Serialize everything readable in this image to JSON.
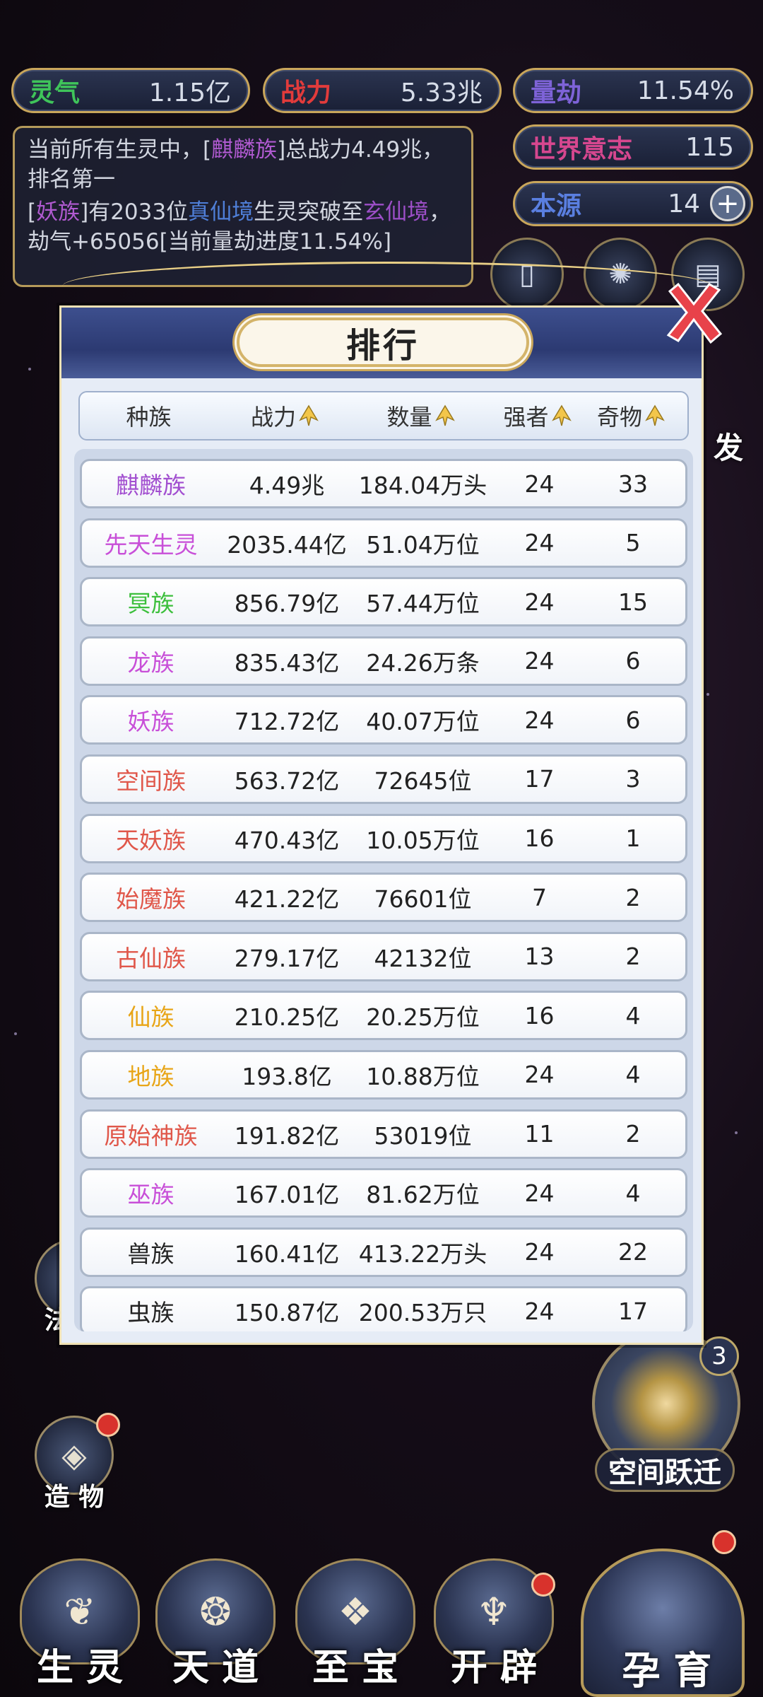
{
  "hud": {
    "lingqi": {
      "label": "灵气",
      "value": "1.15亿",
      "color": "#3fc45a"
    },
    "zhanli": {
      "label": "战力",
      "value": "5.33兆",
      "color": "#e23b3b"
    },
    "liangjie": {
      "label": "量劫",
      "value": "11.54%",
      "color": "#7e63d8"
    },
    "shijie": {
      "label": "世界意志",
      "value": "115",
      "color": "#d6478f"
    },
    "benyuan": {
      "label": "本源",
      "value": "14",
      "color": "#5a7fe0",
      "plus": "+"
    }
  },
  "messages": {
    "line1_a": "当前所有生灵中，[",
    "line1_race": "麒麟族",
    "line1_b": "]总战力4.49兆，排名第一",
    "line2_a": "[",
    "line2_race": "妖族",
    "line2_b": "]有2033位",
    "line2_realm": "真仙境",
    "line2_c": "生灵突破至",
    "line2_realm2": "玄仙境",
    "line2_d": "，劫气+65056[当前量劫进度11.54%]"
  },
  "side_buttons": {
    "fa_ze": "法 则",
    "zao_wu": "造 物",
    "burst_partial": "发",
    "jump": "空间跃迁",
    "jump_badge": "3"
  },
  "bottom_nav": {
    "sheng_ling": "生 灵",
    "tian_dao": "天 道",
    "zhi_bao": "至 宝",
    "kai_pi": "开 辟",
    "yun_yu": "孕 育"
  },
  "modal": {
    "title": "排行",
    "columns": [
      "种族",
      "战力",
      "数量",
      "强者",
      "奇物"
    ],
    "rows": [
      {
        "race": "麒麟族",
        "color": "#a24fd0",
        "power": "4.49兆",
        "count": "184.04万头",
        "strong": "24",
        "treasure": "33"
      },
      {
        "race": "先天生灵",
        "color": "#c84fd8",
        "power": "2035.44亿",
        "count": "51.04万位",
        "strong": "24",
        "treasure": "5"
      },
      {
        "race": "冥族",
        "color": "#3cbf3c",
        "power": "856.79亿",
        "count": "57.44万位",
        "strong": "24",
        "treasure": "15"
      },
      {
        "race": "龙族",
        "color": "#c84fd8",
        "power": "835.43亿",
        "count": "24.26万条",
        "strong": "24",
        "treasure": "6"
      },
      {
        "race": "妖族",
        "color": "#c84fd8",
        "power": "712.72亿",
        "count": "40.07万位",
        "strong": "24",
        "treasure": "6"
      },
      {
        "race": "空间族",
        "color": "#e0574a",
        "power": "563.72亿",
        "count": "72645位",
        "strong": "17",
        "treasure": "3"
      },
      {
        "race": "天妖族",
        "color": "#e0574a",
        "power": "470.43亿",
        "count": "10.05万位",
        "strong": "16",
        "treasure": "1"
      },
      {
        "race": "始魔族",
        "color": "#e0574a",
        "power": "421.22亿",
        "count": "76601位",
        "strong": "7",
        "treasure": "2"
      },
      {
        "race": "古仙族",
        "color": "#e0574a",
        "power": "279.17亿",
        "count": "42132位",
        "strong": "13",
        "treasure": "2"
      },
      {
        "race": "仙族",
        "color": "#e8a517",
        "power": "210.25亿",
        "count": "20.25万位",
        "strong": "16",
        "treasure": "4"
      },
      {
        "race": "地族",
        "color": "#e8a517",
        "power": "193.8亿",
        "count": "10.88万位",
        "strong": "24",
        "treasure": "4"
      },
      {
        "race": "原始神族",
        "color": "#e0574a",
        "power": "191.82亿",
        "count": "53019位",
        "strong": "11",
        "treasure": "2"
      },
      {
        "race": "巫族",
        "color": "#c84fd8",
        "power": "167.01亿",
        "count": "81.62万位",
        "strong": "24",
        "treasure": "4"
      },
      {
        "race": "兽族",
        "color": "#222222",
        "power": "160.41亿",
        "count": "413.22万头",
        "strong": "24",
        "treasure": "22"
      },
      {
        "race": "虫族",
        "color": "#222222",
        "power": "150.87亿",
        "count": "200.53万只",
        "strong": "24",
        "treasure": "17"
      }
    ]
  }
}
